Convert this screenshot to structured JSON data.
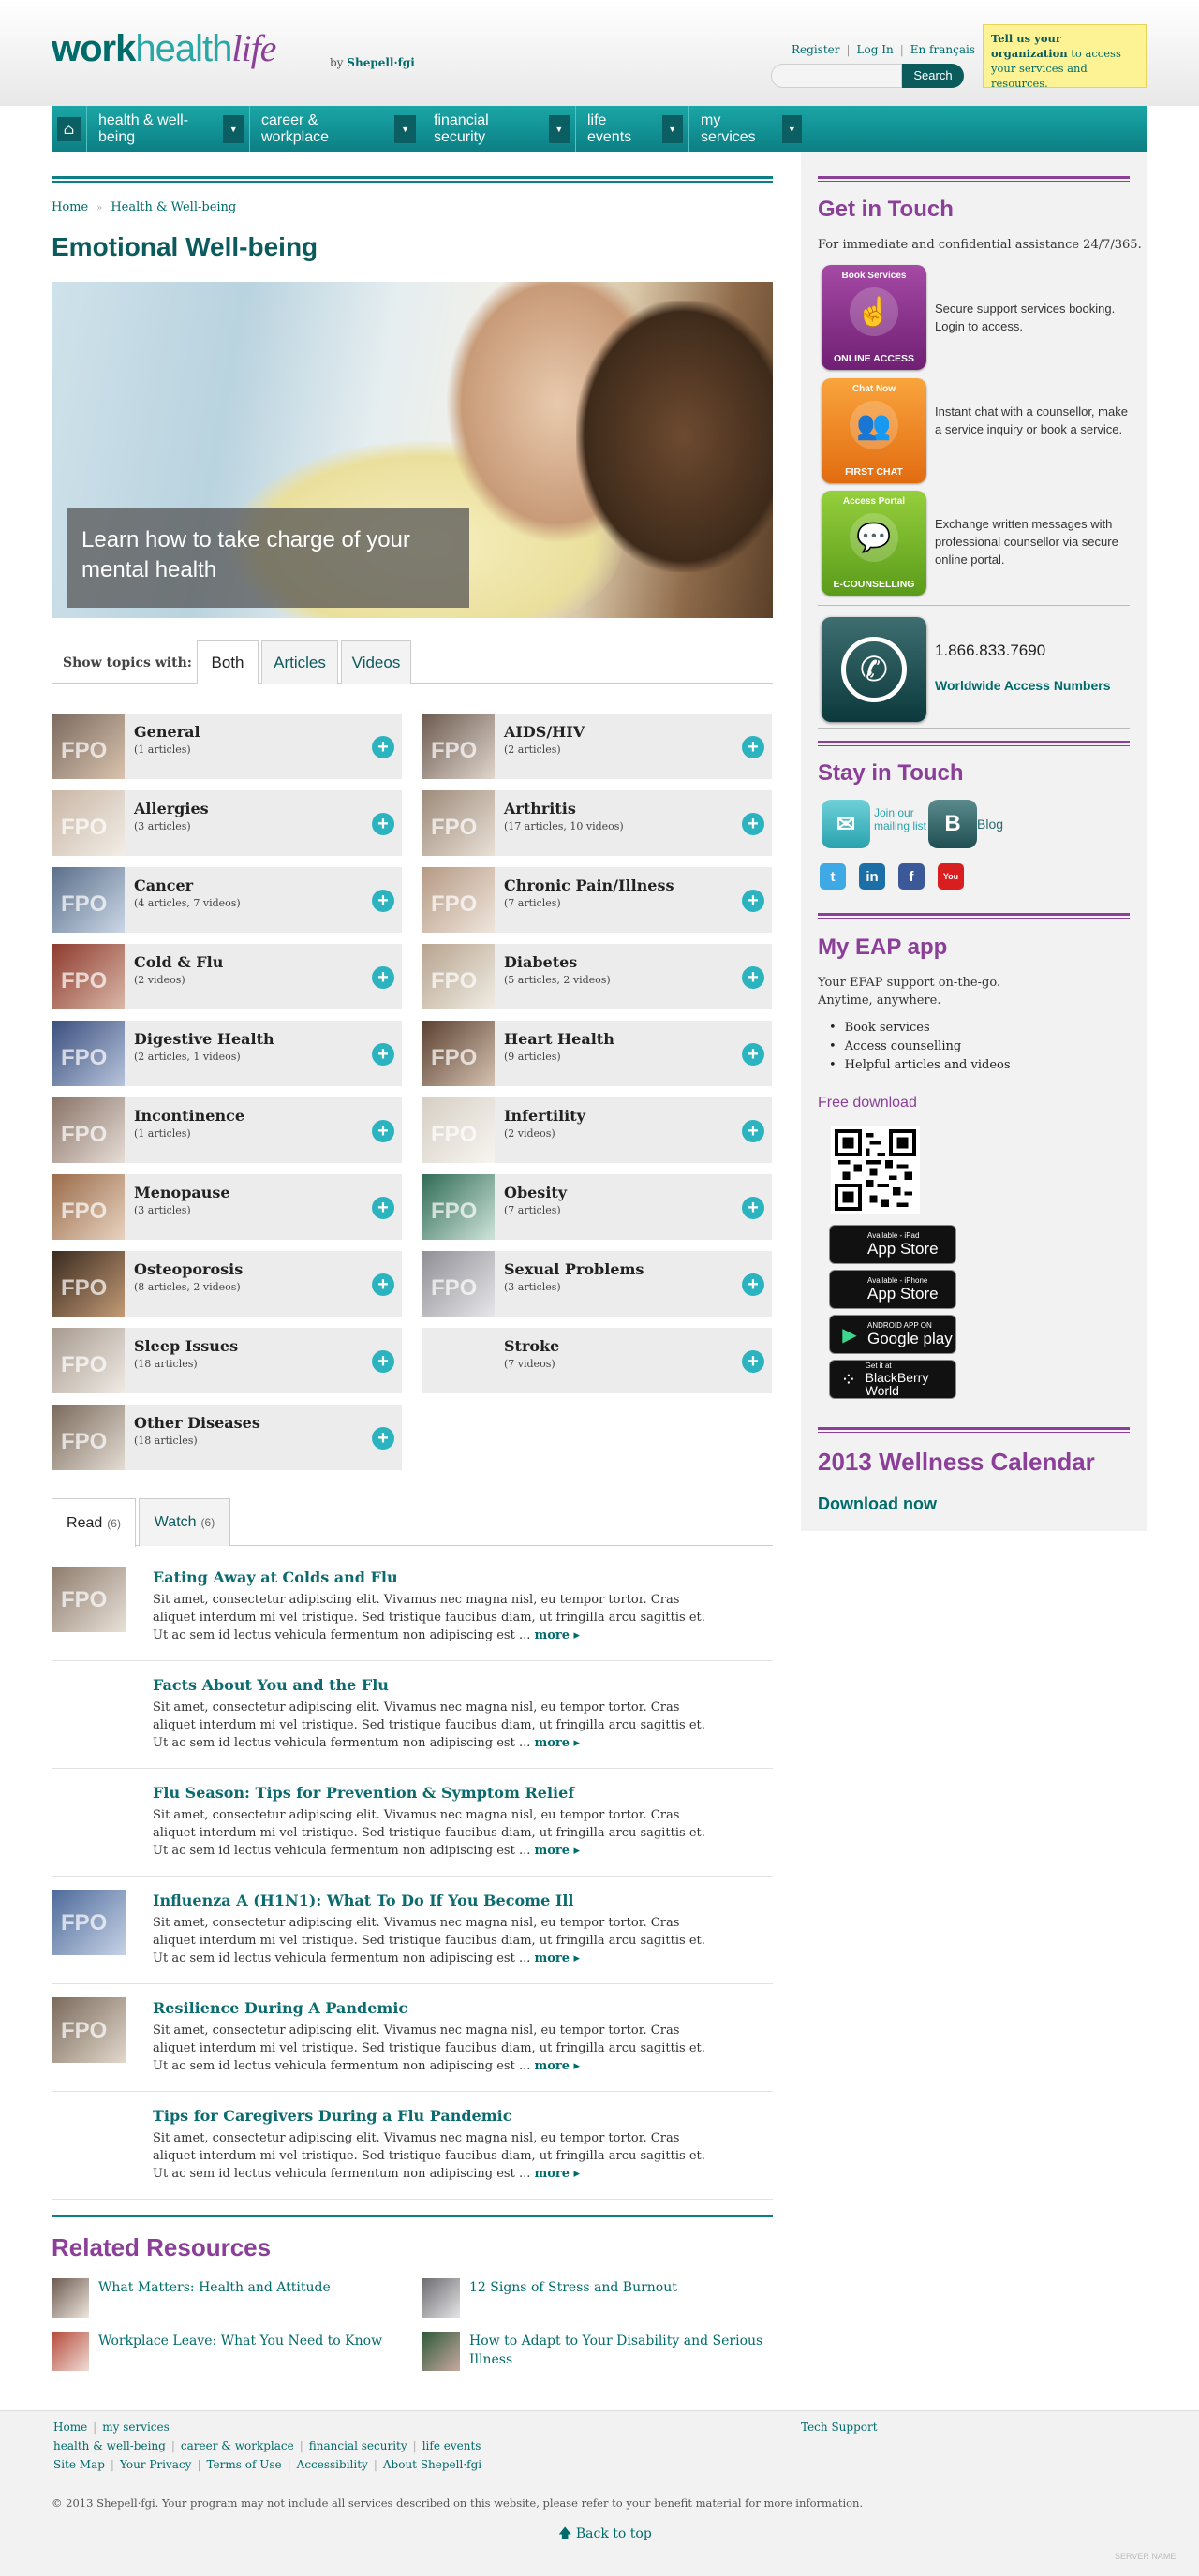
{
  "brand": {
    "logo_work": "work",
    "logo_health": "health",
    "logo_life": "life",
    "by": "by",
    "company": "Shepell·fgi"
  },
  "toplinks": {
    "register": "Register",
    "login": "Log In",
    "french": "En français"
  },
  "search": {
    "placeholder": "",
    "button": "Search"
  },
  "org_notice": {
    "bold": "Tell us your organization",
    "rest": " to access your services and resources."
  },
  "nav": {
    "items": [
      {
        "label": "health & well-being"
      },
      {
        "label": "career & workplace"
      },
      {
        "label": "financial security"
      },
      {
        "label": "life events"
      },
      {
        "label": "my services"
      }
    ]
  },
  "breadcrumb": {
    "home": "Home",
    "current": "Health & Well-being"
  },
  "page_title": "Emotional Well-being",
  "hero": {
    "caption": "Learn how to take charge of your mental health"
  },
  "topic_filter": {
    "label": "Show topics with:",
    "tabs": [
      "Both",
      "Articles",
      "Videos"
    ]
  },
  "topics": [
    {
      "name": "General",
      "count": "(1 articles)"
    },
    {
      "name": "AIDS/HIV",
      "count": "(2 articles)"
    },
    {
      "name": "Allergies",
      "count": "(3 articles)"
    },
    {
      "name": "Arthritis",
      "count": "(17 articles, 10 videos)"
    },
    {
      "name": "Cancer",
      "count": "(4 articles, 7 videos)"
    },
    {
      "name": "Chronic Pain/Illness",
      "count": "(7 articles)"
    },
    {
      "name": "Cold & Flu",
      "count": "(2 videos)"
    },
    {
      "name": "Diabetes",
      "count": "(5 articles, 2 videos)"
    },
    {
      "name": "Digestive Health",
      "count": "(2 articles, 1 videos)"
    },
    {
      "name": "Heart Health",
      "count": "(9 articles)"
    },
    {
      "name": "Incontinence",
      "count": "(1 articles)"
    },
    {
      "name": "Infertility",
      "count": "(2 videos)"
    },
    {
      "name": "Menopause",
      "count": "(3 articles)"
    },
    {
      "name": "Obesity",
      "count": "(7 articles)"
    },
    {
      "name": "Osteoporosis",
      "count": "(8 articles, 2 videos)"
    },
    {
      "name": "Sexual Problems",
      "count": "(3 articles)"
    },
    {
      "name": "Sleep Issues",
      "count": "(18 articles)"
    },
    {
      "name": "Stroke",
      "count": "(7 videos)"
    },
    {
      "name": "Other Diseases",
      "count": "(18 articles)"
    }
  ],
  "fpo_label": "FPO",
  "content_tabs": {
    "read": "Read",
    "read_count": "(6)",
    "watch": "Watch",
    "watch_count": "(6)"
  },
  "articles": [
    {
      "title": "Eating Away at Colds and Flu",
      "body": "Sit amet, consectetur adipiscing elit. Vivamus nec magna nisl, eu tempor tortor. Cras aliquet interdum mi vel tristique. Sed tristique faucibus diam, ut fringilla arcu sagittis et. Ut ac sem id lectus vehicula fermentum non adipiscing est ...",
      "more": "more ▸"
    },
    {
      "title": "Facts About You and the Flu",
      "body": "Sit amet, consectetur adipiscing elit. Vivamus nec magna nisl, eu tempor tortor. Cras aliquet interdum mi vel tristique. Sed tristique faucibus diam, ut fringilla arcu sagittis et. Ut ac sem id lectus vehicula fermentum non adipiscing est ...",
      "more": "more ▸"
    },
    {
      "title": "Flu Season: Tips for Prevention & Symptom Relief",
      "body": "Sit amet, consectetur adipiscing elit. Vivamus nec magna nisl, eu tempor tortor. Cras aliquet interdum mi vel tristique. Sed tristique faucibus diam, ut fringilla arcu sagittis et. Ut ac sem id lectus vehicula fermentum non adipiscing est ...",
      "more": "more ▸"
    },
    {
      "title": "Influenza A (H1N1): What To Do If You Become Ill",
      "body": "Sit amet, consectetur adipiscing elit. Vivamus nec magna nisl, eu tempor tortor. Cras aliquet interdum mi vel tristique. Sed tristique faucibus diam, ut fringilla arcu sagittis et. Ut ac sem id lectus vehicula fermentum non adipiscing est ...",
      "more": "more ▸"
    },
    {
      "title": "Resilience During A Pandemic",
      "body": "Sit amet, consectetur adipiscing elit. Vivamus nec magna nisl, eu tempor tortor. Cras aliquet interdum mi vel tristique. Sed tristique faucibus diam, ut fringilla arcu sagittis et. Ut ac sem id lectus vehicula fermentum non adipiscing est ...",
      "more": "more ▸"
    },
    {
      "title": "Tips for Caregivers During a Flu Pandemic",
      "body": "Sit amet, consectetur adipiscing elit. Vivamus nec magna nisl, eu tempor tortor. Cras aliquet interdum mi vel tristique. Sed tristique faucibus diam, ut fringilla arcu sagittis et. Ut ac sem id lectus vehicula fermentum non adipiscing est ...",
      "more": "more ▸"
    }
  ],
  "related": {
    "title": "Related Resources",
    "items": [
      {
        "label": "What Matters: Health and Attitude"
      },
      {
        "label": "12 Signs of Stress and Burnout"
      },
      {
        "label": "Workplace Leave: What You Need to Know"
      },
      {
        "label": "How to Adapt to Your Disability and Serious Illness"
      }
    ]
  },
  "sidebar": {
    "get_in_touch": {
      "title": "Get in Touch",
      "intro": "For immediate and confidential assistance 24/7/365.",
      "services": [
        {
          "top": "Book Services",
          "bottom": "ONLINE ACCESS",
          "desc": "Secure support services booking. Login to access.",
          "color": "#8b2f8f"
        },
        {
          "top": "Chat Now",
          "bottom": "FIRST CHAT",
          "desc": "Instant chat with a counsellor, make a service inquiry or book a service.",
          "color": "#f08a1c"
        },
        {
          "top": "Access Portal",
          "bottom": "E-COUNSELLING",
          "desc": "Exchange written messages with professional counsellor via secure online portal.",
          "color": "#7ab929"
        }
      ],
      "phone": "1.866.833.7690",
      "worldwide": "Worldwide Access Numbers"
    },
    "stay_in_touch": {
      "title": "Stay in Touch",
      "mailing": "Join our mailing list",
      "blog": "Blog"
    },
    "app": {
      "title": "My EAP app",
      "intro_line1": "Your EFAP support on-the-go.",
      "intro_line2": "Anytime, anywhere.",
      "bullets": [
        "Book services",
        "Access counselling",
        "Helpful articles and videos"
      ],
      "free_download": "Free download",
      "stores": [
        {
          "small": "Available - iPad",
          "big": "App Store",
          "icon": "apple-icon"
        },
        {
          "small": "Available - iPhone",
          "big": "App Store",
          "icon": "apple-icon"
        },
        {
          "small": "ANDROID APP ON",
          "big": "Google play",
          "icon": "play-icon"
        },
        {
          "small": "Get it at",
          "big": "BlackBerry World",
          "icon": "blackberry-icon"
        }
      ]
    },
    "calendar": {
      "title": "2013 Wellness Calendar",
      "link": "Download now"
    }
  },
  "footer": {
    "row1": [
      "Home",
      "my services"
    ],
    "row2": [
      "health & well-being",
      "career & workplace",
      "financial security",
      "life events"
    ],
    "row3": [
      "Site Map",
      "Your Privacy",
      "Terms of Use",
      "Accessibility",
      "About Shepell·fgi"
    ],
    "tech_support": "Tech Support",
    "copyright": "© 2013 Shepell·fgi. Your program may not include all services described on this website, please refer to your benefit material for more information.",
    "back_to_top": "Back to top",
    "server_name": "SERVER NAME"
  },
  "colors": {
    "teal": "#0b7f84",
    "dark_teal": "#0b5a5c",
    "purple": "#8b3f98",
    "accent_plus": "#2bb3bf"
  }
}
